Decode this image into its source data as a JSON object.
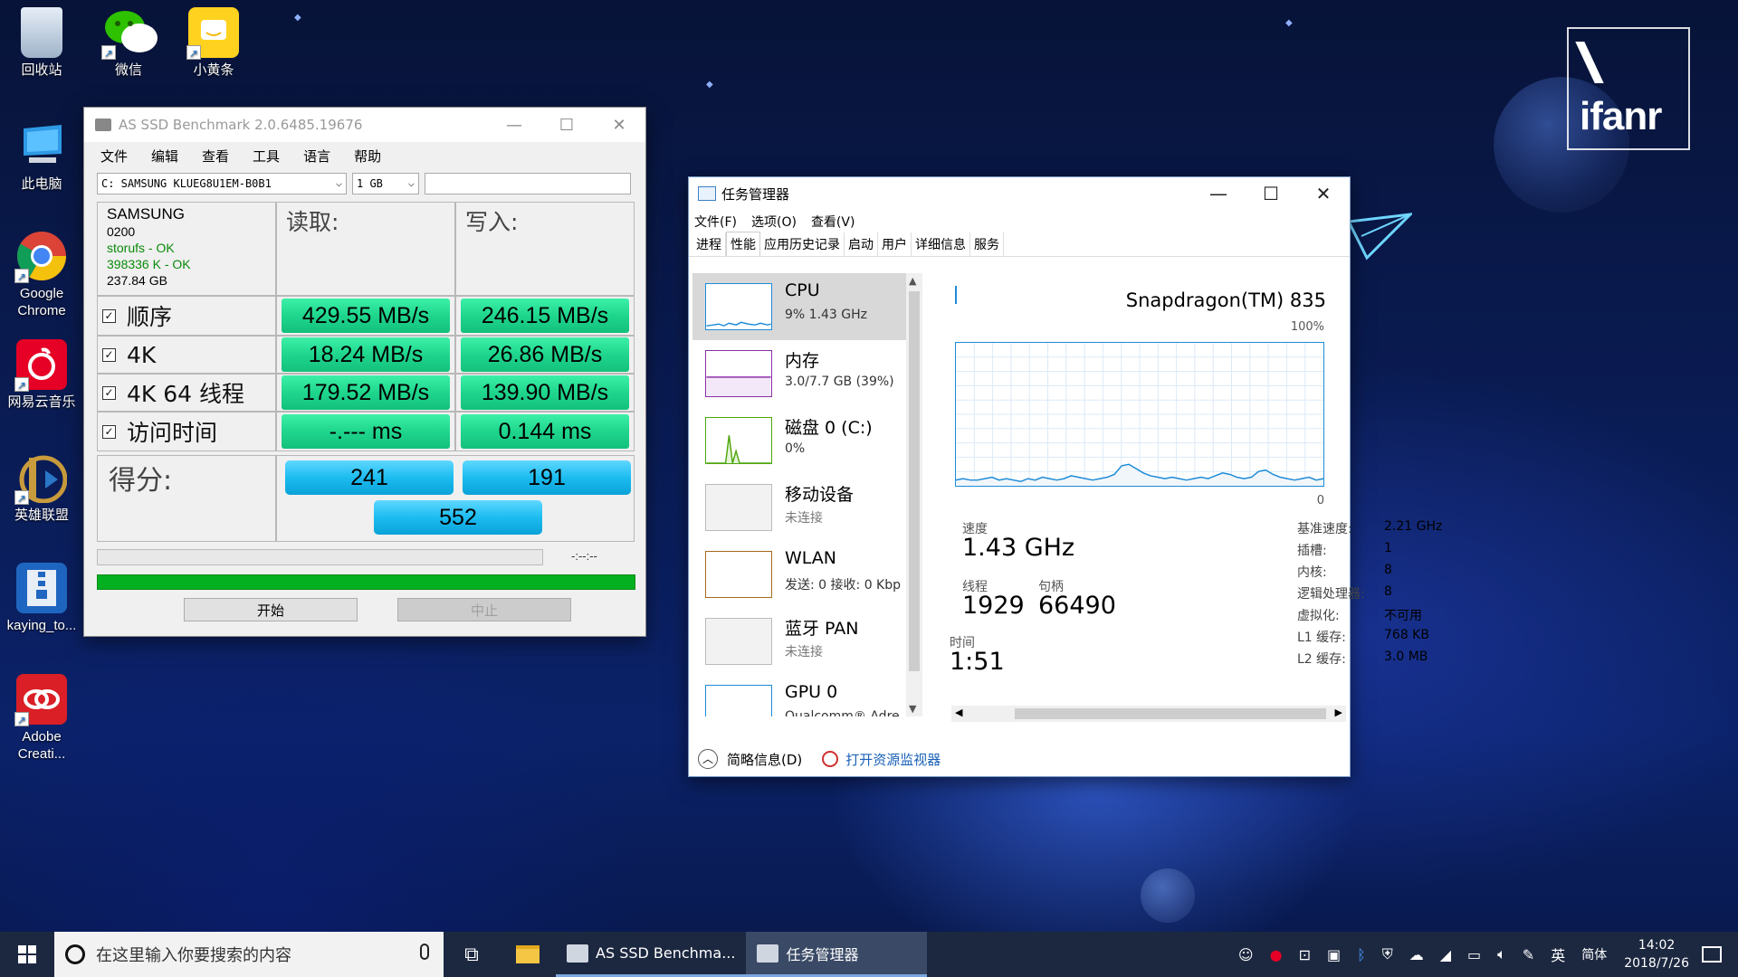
{
  "desktop": {
    "watermark": "ifanr",
    "icons": [
      {
        "label": "回收站",
        "icon": "recycle-bin-icon"
      },
      {
        "label": "微信",
        "icon": "wechat-icon"
      },
      {
        "label": "小黄条",
        "icon": "sticky-note-icon"
      },
      {
        "label": "此电脑",
        "icon": "computer-icon"
      },
      {
        "label": "Google Chrome",
        "icon": "chrome-icon"
      },
      {
        "label": "网易云音乐",
        "icon": "netease-music-icon"
      },
      {
        "label": "英雄联盟",
        "icon": "lol-icon"
      },
      {
        "label": "kaying_to...",
        "icon": "archive-icon"
      },
      {
        "label": "Adobe Creati...",
        "icon": "adobe-cc-icon"
      }
    ]
  },
  "as_ssd": {
    "title": "AS SSD Benchmark 2.0.6485.19676",
    "menu": [
      "文件",
      "编辑",
      "查看",
      "工具",
      "语言",
      "帮助"
    ],
    "drive_select": "C: SAMSUNG KLUEG8U1EM-B0B1",
    "size_select": "1 GB",
    "drive_info": {
      "model": "SAMSUNG",
      "firmware": "0200",
      "driver": "storufs - OK",
      "alignment": "398336 K - OK",
      "capacity": "237.84 GB"
    },
    "headers": {
      "read": "读取:",
      "write": "写入:"
    },
    "rows": [
      {
        "label": "顺序",
        "read": "429.55 MB/s",
        "write": "246.15 MB/s"
      },
      {
        "label": "4K",
        "read": "18.24 MB/s",
        "write": "26.86 MB/s"
      },
      {
        "label": "4K 64 线程",
        "read": "179.52 MB/s",
        "write": "139.90 MB/s"
      },
      {
        "label": "访问时间",
        "read": "-.--- ms",
        "write": "0.144 ms"
      }
    ],
    "score_label": "得分:",
    "score_read": "241",
    "score_write": "191",
    "score_total": "552",
    "elapsed": "-:--:--",
    "start_label": "开始",
    "stop_label": "中止",
    "colors": {
      "bar": "#1fd68d",
      "score": "#1cbcf0",
      "progress": "#05b020"
    }
  },
  "taskmgr": {
    "title": "任务管理器",
    "menu": [
      "文件(F)",
      "选项(O)",
      "查看(V)"
    ],
    "tabs": [
      "进程",
      "性能",
      "应用历史记录",
      "启动",
      "用户",
      "详细信息",
      "服务"
    ],
    "active_tab": "性能",
    "sidebar": [
      {
        "name": "CPU",
        "sub": "9% 1.43 GHz",
        "color": "#1d8bd8"
      },
      {
        "name": "内存",
        "sub": "3.0/7.7 GB (39%)",
        "color": "#8b2fa8"
      },
      {
        "name": "磁盘 0 (C:)",
        "sub": "0%",
        "color": "#4da60c"
      },
      {
        "name": "移动设备",
        "sub": "未连接",
        "color": "#aaaaaa"
      },
      {
        "name": "WLAN",
        "sub": "发送: 0 接收: 0 Kbp",
        "color": "#a66a1e"
      },
      {
        "name": "蓝牙 PAN",
        "sub": "未连接",
        "color": "#aaaaaa"
      },
      {
        "name": "GPU 0",
        "sub": "Qualcomm® Adre",
        "color": "#1d8bd8"
      }
    ],
    "cpu_name": "Snapdragon(TM) 835",
    "graph_max": "100%",
    "graph_min": "0",
    "cpu_usage_history": [
      4,
      5,
      4,
      4,
      5,
      6,
      4,
      5,
      4,
      3,
      5,
      4,
      6,
      5,
      4,
      5,
      7,
      6,
      5,
      4,
      5,
      6,
      8,
      14,
      15,
      12,
      9,
      7,
      6,
      5,
      6,
      5,
      4,
      5,
      6,
      5,
      7,
      9,
      8,
      6,
      5,
      6,
      10,
      11,
      8,
      6,
      5,
      4,
      5,
      6,
      4,
      5
    ],
    "stats": {
      "speed_label": "速度",
      "speed": "1.43 GHz",
      "threads_label": "线程",
      "threads": "1929",
      "handles_label": "句柄",
      "handles": "66490",
      "uptime_label": "时间",
      "uptime": "1:51"
    },
    "specs": [
      {
        "k": "基准速度:",
        "v": "2.21 GHz"
      },
      {
        "k": "插槽:",
        "v": "1"
      },
      {
        "k": "内核:",
        "v": "8"
      },
      {
        "k": "逻辑处理器:",
        "v": "8"
      },
      {
        "k": "虚拟化:",
        "v": "不可用"
      },
      {
        "k": "L1 缓存:",
        "v": "768 KB"
      },
      {
        "k": "L2 缓存:",
        "v": "3.0 MB"
      }
    ],
    "footer": {
      "fewer": "简略信息(D)",
      "resmon": "打开资源监视器"
    }
  },
  "taskbar": {
    "search_placeholder": "在这里输入你要搜索的内容",
    "apps": [
      {
        "label": "AS SSD Benchma..."
      },
      {
        "label": "任务管理器"
      }
    ],
    "ime": "英",
    "ime_mode": "简体",
    "time": "14:02",
    "date": "2018/7/26"
  }
}
